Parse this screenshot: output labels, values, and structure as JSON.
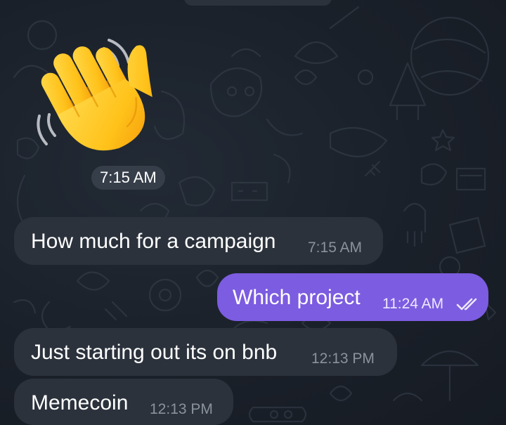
{
  "chat": {
    "sticker": {
      "icon": "waving-hand-icon",
      "time": "7:15 AM"
    },
    "messages": [
      {
        "direction": "incoming",
        "text": "How much for a campaign",
        "time": "7:15 AM"
      },
      {
        "direction": "outgoing",
        "text": "Which project",
        "time": "11:24 AM",
        "status": "read"
      },
      {
        "direction": "incoming",
        "text": "Just starting out its on bnb",
        "time": "12:13 PM"
      },
      {
        "direction": "incoming",
        "text": "Memecoin",
        "time": "12:13 PM"
      }
    ]
  },
  "colors": {
    "background": "#1a2029",
    "incoming_bubble": "#2b323c",
    "outgoing_bubble": "#7c5ce0",
    "timestamp_incoming": "#8a929c"
  }
}
